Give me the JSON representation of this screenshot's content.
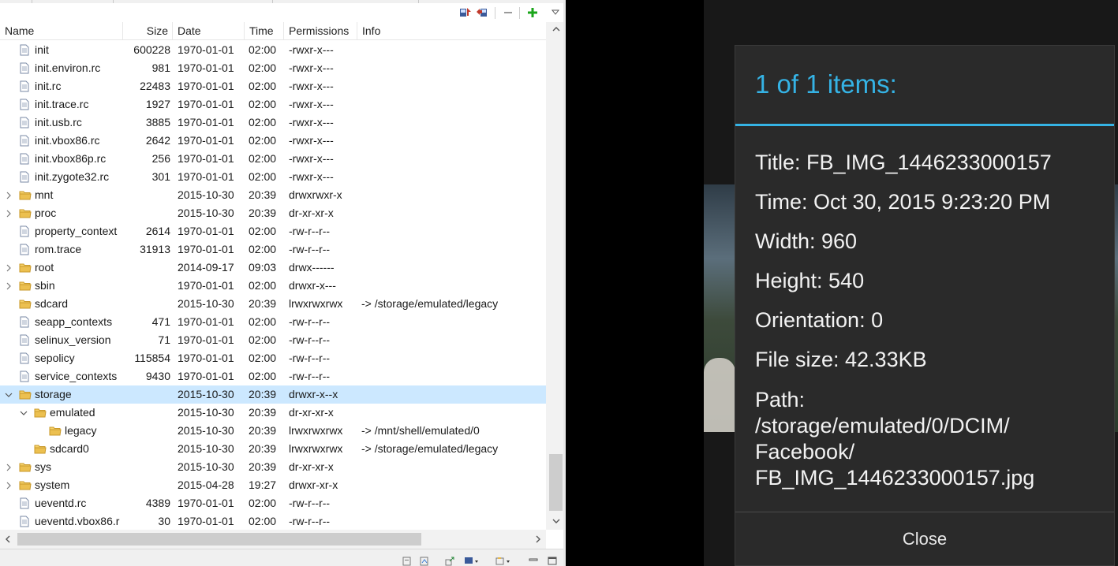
{
  "explorer": {
    "columns": {
      "name": "Name",
      "size": "Size",
      "date": "Date",
      "time": "Time",
      "permissions": "Permissions",
      "info": "Info"
    },
    "rows": [
      {
        "name": "init",
        "size": "600228",
        "date": "1970-01-01",
        "time": "02:00",
        "permissions": "-rwxr-x---",
        "info": "",
        "type": "file",
        "depth": 0
      },
      {
        "name": "init.environ.rc",
        "size": "981",
        "date": "1970-01-01",
        "time": "02:00",
        "permissions": "-rwxr-x---",
        "info": "",
        "type": "file",
        "depth": 0
      },
      {
        "name": "init.rc",
        "size": "22483",
        "date": "1970-01-01",
        "time": "02:00",
        "permissions": "-rwxr-x---",
        "info": "",
        "type": "file",
        "depth": 0
      },
      {
        "name": "init.trace.rc",
        "size": "1927",
        "date": "1970-01-01",
        "time": "02:00",
        "permissions": "-rwxr-x---",
        "info": "",
        "type": "file",
        "depth": 0
      },
      {
        "name": "init.usb.rc",
        "size": "3885",
        "date": "1970-01-01",
        "time": "02:00",
        "permissions": "-rwxr-x---",
        "info": "",
        "type": "file",
        "depth": 0
      },
      {
        "name": "init.vbox86.rc",
        "size": "2642",
        "date": "1970-01-01",
        "time": "02:00",
        "permissions": "-rwxr-x---",
        "info": "",
        "type": "file",
        "depth": 0
      },
      {
        "name": "init.vbox86p.rc",
        "size": "256",
        "date": "1970-01-01",
        "time": "02:00",
        "permissions": "-rwxr-x---",
        "info": "",
        "type": "file",
        "depth": 0
      },
      {
        "name": "init.zygote32.rc",
        "size": "301",
        "date": "1970-01-01",
        "time": "02:00",
        "permissions": "-rwxr-x---",
        "info": "",
        "type": "file",
        "depth": 0
      },
      {
        "name": "mnt",
        "size": "",
        "date": "2015-10-30",
        "time": "20:39",
        "permissions": "drwxrwxr-x",
        "info": "",
        "type": "folder",
        "depth": 0,
        "twisty": "collapsed"
      },
      {
        "name": "proc",
        "size": "",
        "date": "2015-10-30",
        "time": "20:39",
        "permissions": "dr-xr-xr-x",
        "info": "",
        "type": "folder",
        "depth": 0,
        "twisty": "collapsed"
      },
      {
        "name": "property_context",
        "size": "2614",
        "date": "1970-01-01",
        "time": "02:00",
        "permissions": "-rw-r--r--",
        "info": "",
        "type": "file",
        "depth": 0
      },
      {
        "name": "rom.trace",
        "size": "31913",
        "date": "1970-01-01",
        "time": "02:00",
        "permissions": "-rw-r--r--",
        "info": "",
        "type": "file",
        "depth": 0
      },
      {
        "name": "root",
        "size": "",
        "date": "2014-09-17",
        "time": "09:03",
        "permissions": "drwx------",
        "info": "",
        "type": "folder",
        "depth": 0,
        "twisty": "collapsed"
      },
      {
        "name": "sbin",
        "size": "",
        "date": "1970-01-01",
        "time": "02:00",
        "permissions": "drwxr-x---",
        "info": "",
        "type": "folder",
        "depth": 0,
        "twisty": "collapsed"
      },
      {
        "name": "sdcard",
        "size": "",
        "date": "2015-10-30",
        "time": "20:39",
        "permissions": "lrwxrwxrwx",
        "info": "-> /storage/emulated/legacy",
        "type": "folder",
        "depth": 0
      },
      {
        "name": "seapp_contexts",
        "size": "471",
        "date": "1970-01-01",
        "time": "02:00",
        "permissions": "-rw-r--r--",
        "info": "",
        "type": "file",
        "depth": 0
      },
      {
        "name": "selinux_version",
        "size": "71",
        "date": "1970-01-01",
        "time": "02:00",
        "permissions": "-rw-r--r--",
        "info": "",
        "type": "file",
        "depth": 0
      },
      {
        "name": "sepolicy",
        "size": "115854",
        "date": "1970-01-01",
        "time": "02:00",
        "permissions": "-rw-r--r--",
        "info": "",
        "type": "file",
        "depth": 0
      },
      {
        "name": "service_contexts",
        "size": "9430",
        "date": "1970-01-01",
        "time": "02:00",
        "permissions": "-rw-r--r--",
        "info": "",
        "type": "file",
        "depth": 0
      },
      {
        "name": "storage",
        "size": "",
        "date": "2015-10-30",
        "time": "20:39",
        "permissions": "drwxr-x--x",
        "info": "",
        "type": "folder",
        "depth": 0,
        "twisty": "expanded",
        "selected": true
      },
      {
        "name": "emulated",
        "size": "",
        "date": "2015-10-30",
        "time": "20:39",
        "permissions": "dr-xr-xr-x",
        "info": "",
        "type": "folder",
        "depth": 1,
        "twisty": "expanded"
      },
      {
        "name": "legacy",
        "size": "",
        "date": "2015-10-30",
        "time": "20:39",
        "permissions": "lrwxrwxrwx",
        "info": "-> /mnt/shell/emulated/0",
        "type": "folder",
        "depth": 2
      },
      {
        "name": "sdcard0",
        "size": "",
        "date": "2015-10-30",
        "time": "20:39",
        "permissions": "lrwxrwxrwx",
        "info": "-> /storage/emulated/legacy",
        "type": "folder",
        "depth": 1
      },
      {
        "name": "sys",
        "size": "",
        "date": "2015-10-30",
        "time": "20:39",
        "permissions": "dr-xr-xr-x",
        "info": "",
        "type": "folder",
        "depth": 0,
        "twisty": "collapsed"
      },
      {
        "name": "system",
        "size": "",
        "date": "2015-04-28",
        "time": "19:27",
        "permissions": "drwxr-xr-x",
        "info": "",
        "type": "folder",
        "depth": 0,
        "twisty": "collapsed"
      },
      {
        "name": "ueventd.rc",
        "size": "4389",
        "date": "1970-01-01",
        "time": "02:00",
        "permissions": "-rw-r--r--",
        "info": "",
        "type": "file",
        "depth": 0
      },
      {
        "name": "ueventd.vbox86.r",
        "size": "30",
        "date": "1970-01-01",
        "time": "02:00",
        "permissions": "-rw-r--r--",
        "info": "",
        "type": "file",
        "depth": 0
      }
    ]
  },
  "dialog": {
    "title": "1 of 1 items:",
    "title_line": "Title: FB_IMG_1446233000157",
    "time_line": "Time: Oct 30, 2015 9:23:20 PM",
    "width_line": "Width: 960",
    "height_line": "Height: 540",
    "orientation_line": "Orientation: 0",
    "filesize_line": "File size: 42.33KB",
    "path_label": "Path:",
    "path_value": "/storage/emulated/0/DCIM/ Facebook/ FB_IMG_1446233000157.jpg",
    "close_label": "Close"
  },
  "colors": {
    "accent": "#35b3e5",
    "selection": "#cce8ff",
    "dialog_bg": "#2a2a2a",
    "folder": "#e8b84a"
  },
  "icons": {
    "pull": "pull-file-icon",
    "push": "push-file-icon",
    "delete": "delete-icon",
    "new_folder": "add-icon",
    "menu": "view-menu-chevron-icon"
  }
}
